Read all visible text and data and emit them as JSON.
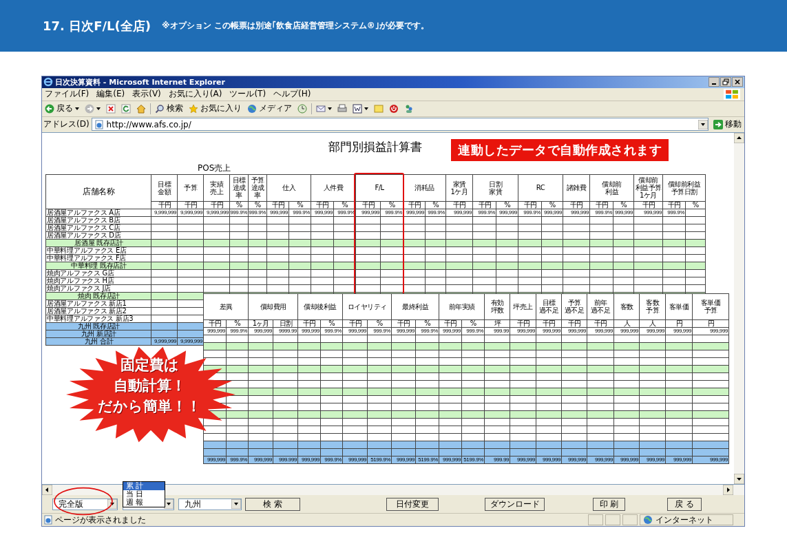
{
  "slide": {
    "heading": "17. 日次F/L(全店)",
    "note": "※オプション この帳票は別途｢飲食店経営管理システム®｣が必要です。"
  },
  "browser": {
    "title": "日次決算資料 - Microsoft Internet Explorer",
    "menu": [
      "ファイル(F)",
      "編集(E)",
      "表示(V)",
      "お気に入り(A)",
      "ツール(T)",
      "ヘルプ(H)"
    ],
    "toolbar": [
      "戻る",
      "検索",
      "お気に入り",
      "メディア"
    ],
    "address": {
      "label": "アドレス(D)",
      "url": "http://www.afs.co.jp/",
      "go": "移動"
    },
    "status": {
      "text": "ページが表示されました",
      "zone": "インターネット"
    }
  },
  "report": {
    "title": "部門別損益計算書",
    "auto_banner": "連動したデータで自動作成されます",
    "section_label": "POS売上",
    "table": {
      "store_header": "店舗名称",
      "columns": [
        {
          "lines": [
            "目標",
            "金額"
          ],
          "units": [
            "千円"
          ]
        },
        {
          "lines": [
            "予算"
          ],
          "units": [
            "千円"
          ]
        },
        {
          "lines": [
            "実績",
            "売上"
          ],
          "units": [
            "千円"
          ]
        },
        {
          "lines": [
            "目標",
            "達成",
            "率"
          ],
          "units": [
            "%"
          ]
        },
        {
          "lines": [
            "予算",
            "達成",
            "率"
          ],
          "units": [
            "%"
          ]
        },
        {
          "lines": [
            "仕入"
          ],
          "units": [
            "千円",
            "%"
          ]
        },
        {
          "lines": [
            "人件費"
          ],
          "units": [
            "千円",
            "%"
          ]
        },
        {
          "lines": [
            "F/L"
          ],
          "units": [
            "千円",
            "%"
          ]
        },
        {
          "lines": [
            "消耗品"
          ],
          "units": [
            "千円",
            "%"
          ]
        },
        {
          "lines": [
            "家賃",
            "1ケ月"
          ],
          "units": [
            "千円"
          ]
        },
        {
          "lines": [
            "日割",
            "家賃"
          ],
          "units": [
            "千円",
            "%"
          ]
        },
        {
          "lines": [
            "RC"
          ],
          "units": [
            "千円",
            "%"
          ]
        },
        {
          "lines": [
            "諸雑費"
          ],
          "units": [
            "千円"
          ]
        },
        {
          "lines": [
            "償却前",
            "利益"
          ],
          "units": [
            "千円",
            "%"
          ]
        },
        {
          "lines": [
            "償却前",
            "利益予算",
            "1ケ月"
          ],
          "units": [
            "千円"
          ]
        },
        {
          "lines": [
            "償却前利益",
            "予算日割"
          ],
          "units": [
            "千円",
            "%"
          ]
        }
      ],
      "rows": [
        {
          "name": "居酒屋アルファクス A店",
          "kind": "store",
          "values": [
            "9,999,999",
            "9,999,999",
            "9,999,999",
            "999.9%",
            "999.9%",
            "999,999",
            "999.9%",
            "999,999",
            "999.9%",
            "999,999",
            "999.9%",
            "999,999",
            "999.9%",
            "999,999",
            "999.9%",
            "999,999",
            "999.9%",
            "999,999",
            "999,999",
            "999.9%",
            "999,999",
            "999,999",
            "999.9%"
          ]
        },
        {
          "name": "居酒屋アルファクス B店",
          "kind": "store"
        },
        {
          "name": "居酒屋アルファクス C店",
          "kind": "store"
        },
        {
          "name": "居酒屋アルファクス D店",
          "kind": "store"
        },
        {
          "name": "居酒屋 既存店計",
          "kind": "subtotal"
        },
        {
          "name": "中華料理アルファクス E店",
          "kind": "store"
        },
        {
          "name": "中華料理アルファクス F店",
          "kind": "store"
        },
        {
          "name": "中華料理 既存店計",
          "kind": "subtotal"
        },
        {
          "name": "焼肉アルファクス G店",
          "kind": "store"
        },
        {
          "name": "焼肉アルファクス H店",
          "kind": "store"
        },
        {
          "name": "焼肉アルファクス J店",
          "kind": "store"
        },
        {
          "name": "焼肉 既存店計",
          "kind": "subtotal"
        },
        {
          "name": "居酒屋アルファクス 新店1",
          "kind": "store"
        },
        {
          "name": "居酒屋アルファクス 新店2",
          "kind": "store"
        },
        {
          "name": "中華料理アルファクス 新店3",
          "kind": "store"
        },
        {
          "name": "九州 既存店計",
          "kind": "total"
        },
        {
          "name": "九州 新店計",
          "kind": "total"
        },
        {
          "name": "九州 合計",
          "kind": "total",
          "values": [
            "9,999,999",
            "9,999,999"
          ]
        }
      ]
    },
    "detail_table": {
      "columns": [
        {
          "lines": [
            "差異"
          ],
          "units": [
            "千円",
            "%"
          ]
        },
        {
          "lines": [
            "償却費用"
          ],
          "units": [
            "1ヶ月",
            "日割"
          ]
        },
        {
          "lines": [
            "償却後利益"
          ],
          "units": [
            "千円",
            "%"
          ]
        },
        {
          "lines": [
            "ロイヤリティ"
          ],
          "units": [
            "千円",
            "%"
          ]
        },
        {
          "lines": [
            "最終利益"
          ],
          "units": [
            "千円",
            "%"
          ]
        },
        {
          "lines": [
            "前年実績"
          ],
          "units": [
            "千円",
            "%"
          ]
        },
        {
          "lines": [
            "有効",
            "坪数"
          ],
          "units": [
            "坪"
          ]
        },
        {
          "lines": [
            "坪売上"
          ],
          "units": [
            "千円"
          ]
        },
        {
          "lines": [
            "目標",
            "過不足"
          ],
          "units": [
            "千円"
          ]
        },
        {
          "lines": [
            "予算",
            "過不足"
          ],
          "units": [
            "千円"
          ]
        },
        {
          "lines": [
            "前年",
            "過不足"
          ],
          "units": [
            "千円"
          ]
        },
        {
          "lines": [
            "客数"
          ],
          "units": [
            "人"
          ]
        },
        {
          "lines": [
            "客数",
            "予算"
          ],
          "units": [
            "人"
          ]
        },
        {
          "lines": [
            "客単価"
          ],
          "units": [
            "円"
          ]
        },
        {
          "lines": [
            "客単価",
            "予算"
          ],
          "units": [
            "円"
          ]
        }
      ],
      "rows": [
        {
          "kind": "store",
          "values": [
            "999,999",
            "999.9%",
            "999,999",
            "9999.99",
            "999,999",
            "999.9%",
            "999,999",
            "999.9%",
            "999,999",
            "999.9%",
            "999,999",
            "999.9%",
            "999.99",
            "999,999",
            "999,999",
            "999,999",
            "999,999",
            "999,999",
            "999,999",
            "999,999",
            "999,999"
          ]
        },
        {
          "kind": "store"
        },
        {
          "kind": "subtotal"
        },
        {
          "kind": "store"
        },
        {
          "kind": "store"
        },
        {
          "kind": "subtotal"
        },
        {
          "kind": "store"
        },
        {
          "kind": "store"
        },
        {
          "kind": "subtotal"
        },
        {
          "kind": "store"
        },
        {
          "kind": "store"
        },
        {
          "kind": "subtotal"
        },
        {
          "kind": "store"
        },
        {
          "kind": "store"
        },
        {
          "kind": "store"
        },
        {
          "kind": "total"
        },
        {
          "kind": "total"
        },
        {
          "kind": "total",
          "values": [
            "999,999",
            "999.9%",
            "999,999",
            "999.999",
            "999,999",
            "999.9%",
            "999,999",
            "5199.9%",
            "999,999",
            "5199.9%",
            "999,999",
            "5199.9%",
            "999.99",
            "999,999",
            "999,999",
            "999,999",
            "999,999",
            "999,999",
            "999,999",
            "999,999",
            "999,999"
          ]
        }
      ]
    },
    "callout": {
      "lines": [
        "固定費は",
        "自動計算！",
        "だから簡単！！"
      ]
    }
  },
  "controls": {
    "edition": "完全版",
    "period_options": [
      {
        "label": "累 計",
        "selected": true
      },
      {
        "label": "当 日",
        "selected": false
      },
      {
        "label": "週 報",
        "selected": false
      }
    ],
    "region": "九州",
    "buttons": [
      "検 索",
      "日付変更",
      "ダウンロード",
      "印 刷",
      "戻 る"
    ]
  }
}
